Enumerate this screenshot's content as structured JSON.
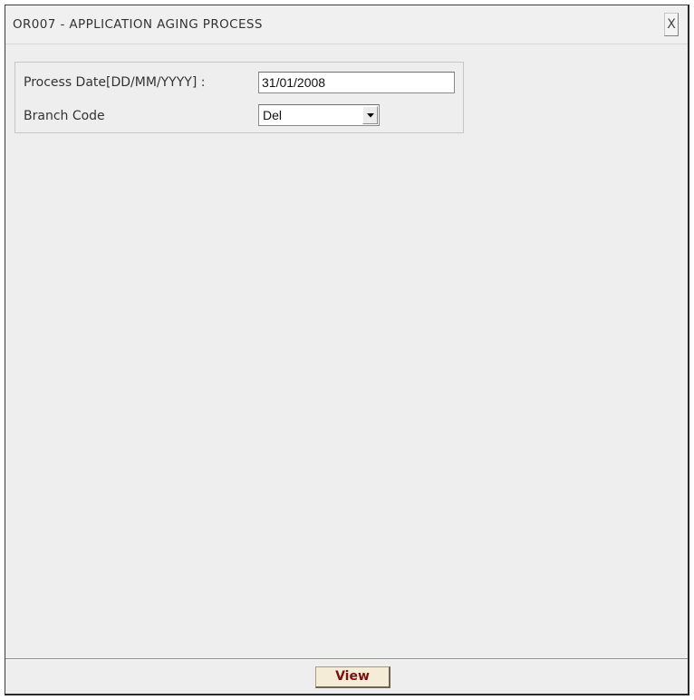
{
  "window": {
    "title": "OR007 - APPLICATION AGING PROCESS",
    "close_label": "X"
  },
  "form": {
    "process_date": {
      "label": "Process Date[DD/MM/YYYY] :",
      "value": "31/01/2008"
    },
    "branch_code": {
      "label": "Branch Code",
      "selected": "Del"
    }
  },
  "footer": {
    "view_label": "View"
  },
  "colors": {
    "window_bg": "#eeeeee",
    "button_text": "#7a1010",
    "button_bg": "#f4ecd6"
  }
}
